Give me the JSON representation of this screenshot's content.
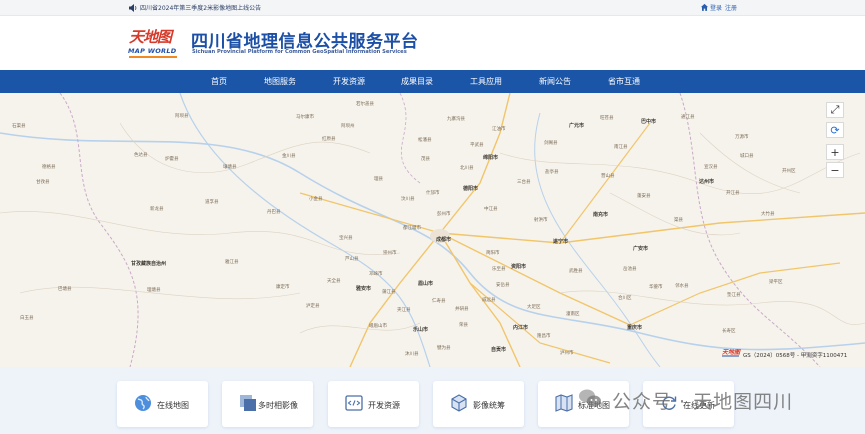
{
  "notice": {
    "text": "四川省2024年第三季度2米影像地图上线公告",
    "login": "登录",
    "register": "注册"
  },
  "header": {
    "logo_cn": "天地图",
    "logo_en": "MAP WORLD",
    "title": "四川省地理信息公共服务平台",
    "subtitle": "Sichuan Provincial Platform for Common GeoSpatial Information Services"
  },
  "nav": [
    {
      "label": "首页"
    },
    {
      "label": "地图服务"
    },
    {
      "label": "开发资源"
    },
    {
      "label": "成果目录"
    },
    {
      "label": "工具应用"
    },
    {
      "label": "新闻公告"
    },
    {
      "label": "省市互通"
    }
  ],
  "map": {
    "copyright": "GS（2024）0568号 - 甲测资字1100471",
    "badge": "天地图",
    "controls": [
      "⤢",
      "⟳",
      "+",
      "−"
    ],
    "labels": [
      {
        "t": "若尔盖县"
      },
      {
        "t": "马尔康市"
      },
      {
        "t": "金川县"
      },
      {
        "t": "小金县"
      },
      {
        "t": "阿坝州"
      },
      {
        "t": "红原县"
      },
      {
        "t": "理县"
      },
      {
        "t": "汶川县"
      },
      {
        "t": "茂县"
      },
      {
        "t": "松潘县"
      },
      {
        "t": "九寨沟县"
      },
      {
        "t": "平武县"
      },
      {
        "t": "北川县"
      },
      {
        "t": "江油市"
      },
      {
        "t": "绵阳市"
      },
      {
        "t": "剑阁县"
      },
      {
        "t": "广元市"
      },
      {
        "t": "旺苍县"
      },
      {
        "t": "南江县"
      },
      {
        "t": "巴中市"
      },
      {
        "t": "通江县"
      },
      {
        "t": "万源市"
      },
      {
        "t": "宣汉县"
      },
      {
        "t": "达州市"
      },
      {
        "t": "开江县"
      },
      {
        "t": "大竹县"
      },
      {
        "t": "渠县"
      },
      {
        "t": "营山县"
      },
      {
        "t": "南充市"
      },
      {
        "t": "蓬安县"
      },
      {
        "t": "广安市"
      },
      {
        "t": "岳池县"
      },
      {
        "t": "遂宁市"
      },
      {
        "t": "射洪市"
      },
      {
        "t": "三台县"
      },
      {
        "t": "盐亭县"
      },
      {
        "t": "德阳市"
      },
      {
        "t": "什邡市"
      },
      {
        "t": "都江堰市"
      },
      {
        "t": "彭州市"
      },
      {
        "t": "成都市"
      },
      {
        "t": "崇州市"
      },
      {
        "t": "邛崃市"
      },
      {
        "t": "蒲江县"
      },
      {
        "t": "眉山市"
      },
      {
        "t": "雅安市"
      },
      {
        "t": "天全县"
      },
      {
        "t": "芦山县"
      },
      {
        "t": "宝兴县"
      },
      {
        "t": "乐山市"
      },
      {
        "t": "峨眉山市"
      },
      {
        "t": "夹江县"
      },
      {
        "t": "资阳市"
      },
      {
        "t": "简阳市"
      },
      {
        "t": "内江市"
      },
      {
        "t": "自贡市"
      },
      {
        "t": "荣县"
      },
      {
        "t": "威远县"
      },
      {
        "t": "隆昌市"
      },
      {
        "t": "泸州市"
      },
      {
        "t": "重庆市"
      },
      {
        "t": "合川区"
      },
      {
        "t": "甘孜藏族自治州"
      },
      {
        "t": "炉霍县"
      },
      {
        "t": "道孚县"
      },
      {
        "t": "丹巴县"
      },
      {
        "t": "康定市"
      },
      {
        "t": "泸定县"
      },
      {
        "t": "色达县"
      },
      {
        "t": "甘孜县"
      },
      {
        "t": "新龙县"
      },
      {
        "t": "理塘县"
      },
      {
        "t": "巴塘县"
      },
      {
        "t": "雅江县"
      },
      {
        "t": "石渠县"
      },
      {
        "t": "德格县"
      },
      {
        "t": "白玉县"
      },
      {
        "t": "壤塘县"
      },
      {
        "t": "阿坝县"
      },
      {
        "t": "梁平区"
      },
      {
        "t": "垫江县"
      },
      {
        "t": "长寿区"
      },
      {
        "t": "邻水县"
      },
      {
        "t": "华蓥市"
      },
      {
        "t": "武胜县"
      },
      {
        "t": "潼南区"
      },
      {
        "t": "大足区"
      },
      {
        "t": "安岳县"
      },
      {
        "t": "乐至县"
      },
      {
        "t": "中江县"
      },
      {
        "t": "仁寿县"
      },
      {
        "t": "井研县"
      },
      {
        "t": "犍为县"
      },
      {
        "t": "沐川县"
      },
      {
        "t": "开州区"
      },
      {
        "t": "城口县"
      }
    ]
  },
  "services": [
    {
      "label": "在线地图",
      "icon": "globe-icon"
    },
    {
      "label": "多时相影像",
      "icon": "layers-icon"
    },
    {
      "label": "开发资源",
      "icon": "code-icon"
    },
    {
      "label": "影像统筹",
      "icon": "cube-icon"
    },
    {
      "label": "标准地图",
      "icon": "map-icon"
    },
    {
      "label": "在线更新",
      "icon": "refresh-icon"
    }
  ],
  "watermark": {
    "text": "公众号 · 天地图四川"
  },
  "colors": {
    "nav_bg": "#1a55a8",
    "title": "#1c4fa6",
    "map_bg": "#f6f3ec"
  }
}
